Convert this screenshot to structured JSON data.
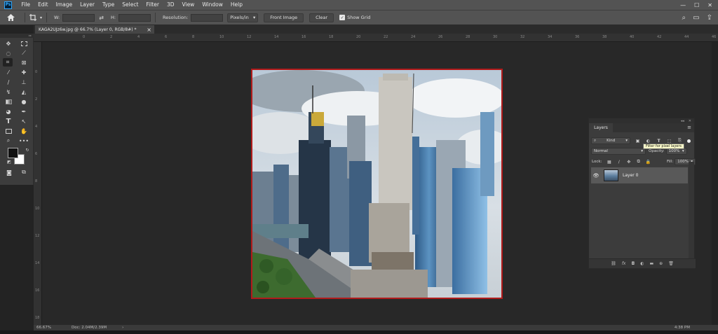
{
  "menu": [
    "File",
    "Edit",
    "Image",
    "Layer",
    "Type",
    "Select",
    "Filter",
    "3D",
    "View",
    "Window",
    "Help"
  ],
  "app_logo": "Ps",
  "window_controls": [
    "—",
    "☐",
    "✕"
  ],
  "options": {
    "w_label": "W:",
    "h_label": "H:",
    "swap": "⇄",
    "resolution_label": "Resolution:",
    "units": "Pixels/in",
    "front_image": "Front Image",
    "clear": "Clear",
    "show_grid": "Show Grid"
  },
  "doc_tab": {
    "title": "KAGA2UJz6w.jpg @ 66.7% (Layer 0, RGB/8#) *",
    "close": "×"
  },
  "ruler_h_marks": [
    "0",
    "2",
    "4",
    "6",
    "8",
    "10",
    "12",
    "14",
    "16",
    "18",
    "20",
    "22",
    "24",
    "26",
    "28",
    "30",
    "32",
    "34",
    "36",
    "38",
    "40",
    "42",
    "44",
    "46",
    "48"
  ],
  "ruler_v_marks": [
    "0",
    "2",
    "4",
    "6",
    "8",
    "10",
    "12",
    "14",
    "16",
    "18"
  ],
  "status": {
    "zoom": "66.67%",
    "doc": "Doc: 2.04M/2.39M",
    "arrow": "›",
    "clock": "4:38 PM"
  },
  "layers_panel": {
    "tab": "Layers",
    "collapse": "◂◂",
    "close": "✕",
    "menu": "≡",
    "filter_kind": "Kind",
    "tooltip": "Filter for pixel layers",
    "blend_mode": "Normal",
    "opacity_label": "Opacity:",
    "opacity_value": "100%",
    "lock_label": "Lock:",
    "fill_label": "Fill:",
    "fill_value": "100%",
    "layer_name": "Layer 0",
    "footer_icons": [
      "link-icon",
      "fx-icon",
      "mask-icon",
      "adjustment-icon",
      "folder-icon",
      "new-layer-icon",
      "trash-icon"
    ],
    "footer_glyphs": [
      "⛓",
      "fx",
      "◘",
      "◐",
      "▬",
      "⊕",
      "🗑"
    ]
  },
  "colors": {
    "accent": "#31a8ff",
    "canvas_border": "#b11b1b",
    "tooltip_bg": "#ffffcc"
  }
}
